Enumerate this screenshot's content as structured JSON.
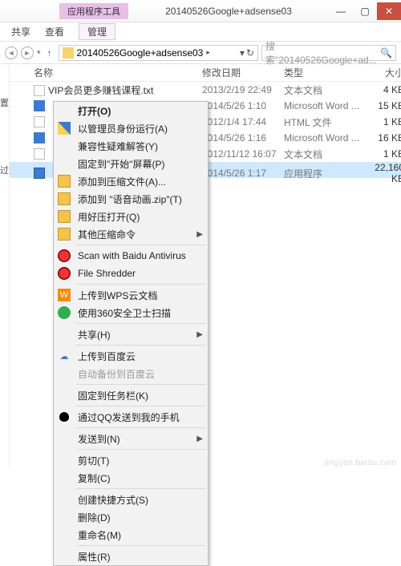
{
  "title_tab": "应用程序工具",
  "window_title": "20140526Google+adsense03",
  "ribbon": {
    "share": "共享",
    "view": "查看",
    "manage": "管理"
  },
  "path_text": "20140526Google+adsense03",
  "search_placeholder": "搜索\"20140526Google+ad...",
  "side": {
    "a": "置",
    "b": "过"
  },
  "columns": {
    "name": "名称",
    "date": "修改日期",
    "type": "类型",
    "size": "大小"
  },
  "rows": [
    {
      "name": "VIP会员更多赚钱课程.txt",
      "date": "2013/2/19 22:49",
      "type": "文本文档",
      "size": "4 KB",
      "icon": "ic-txt"
    },
    {
      "name": "",
      "date": "2014/5/26 1:10",
      "type": "Microsoft Word ...",
      "size": "15 KB",
      "icon": "ic-doc"
    },
    {
      "name": "",
      "date": "2012/1/4 17:44",
      "type": "HTML 文件",
      "size": "1 KB",
      "icon": "ic-html"
    },
    {
      "name": "",
      "date": "2014/5/26 1:16",
      "type": "Microsoft Word ...",
      "size": "16 KB",
      "icon": "ic-doc"
    },
    {
      "name": "",
      "date": "2012/11/12 16:07",
      "type": "文本文档",
      "size": "1 KB",
      "icon": "ic-txt"
    },
    {
      "name": "",
      "date": "2014/5/26 1:17",
      "type": "应用程序",
      "size": "22,160 KB",
      "icon": "ic-exe",
      "selected": true
    }
  ],
  "ctx": {
    "open": "打开(O)",
    "run_admin": "以管理员身份运行(A)",
    "troubleshoot": "兼容性疑难解答(Y)",
    "pin_start": "固定到\"开始\"屏幕(P)",
    "add_zip": "添加到压缩文件(A)...",
    "add_named": "添加到 \"语音动画.zip\"(T)",
    "open_hao": "用好压打开(Q)",
    "other_zip": "其他压缩命令",
    "scan_av": "Scan with Baidu Antivirus",
    "shredder": "File Shredder",
    "wps_cloud": "上传到WPS云文档",
    "scan_360": "使用360安全卫士扫描",
    "share": "共享(H)",
    "baidu_cloud": "上传到百度云",
    "baidu_auto": "自动备份到百度云",
    "pin_task": "固定到任务栏(K)",
    "qq_send": "通过QQ发送到我的手机",
    "send_to": "发送到(N)",
    "cut": "剪切(T)",
    "copy": "复制(C)",
    "shortcut": "创建快捷方式(S)",
    "delete": "删除(D)",
    "rename": "重命名(M)",
    "props": "属性(R)"
  },
  "watermark": "jingyan.baidu.com"
}
